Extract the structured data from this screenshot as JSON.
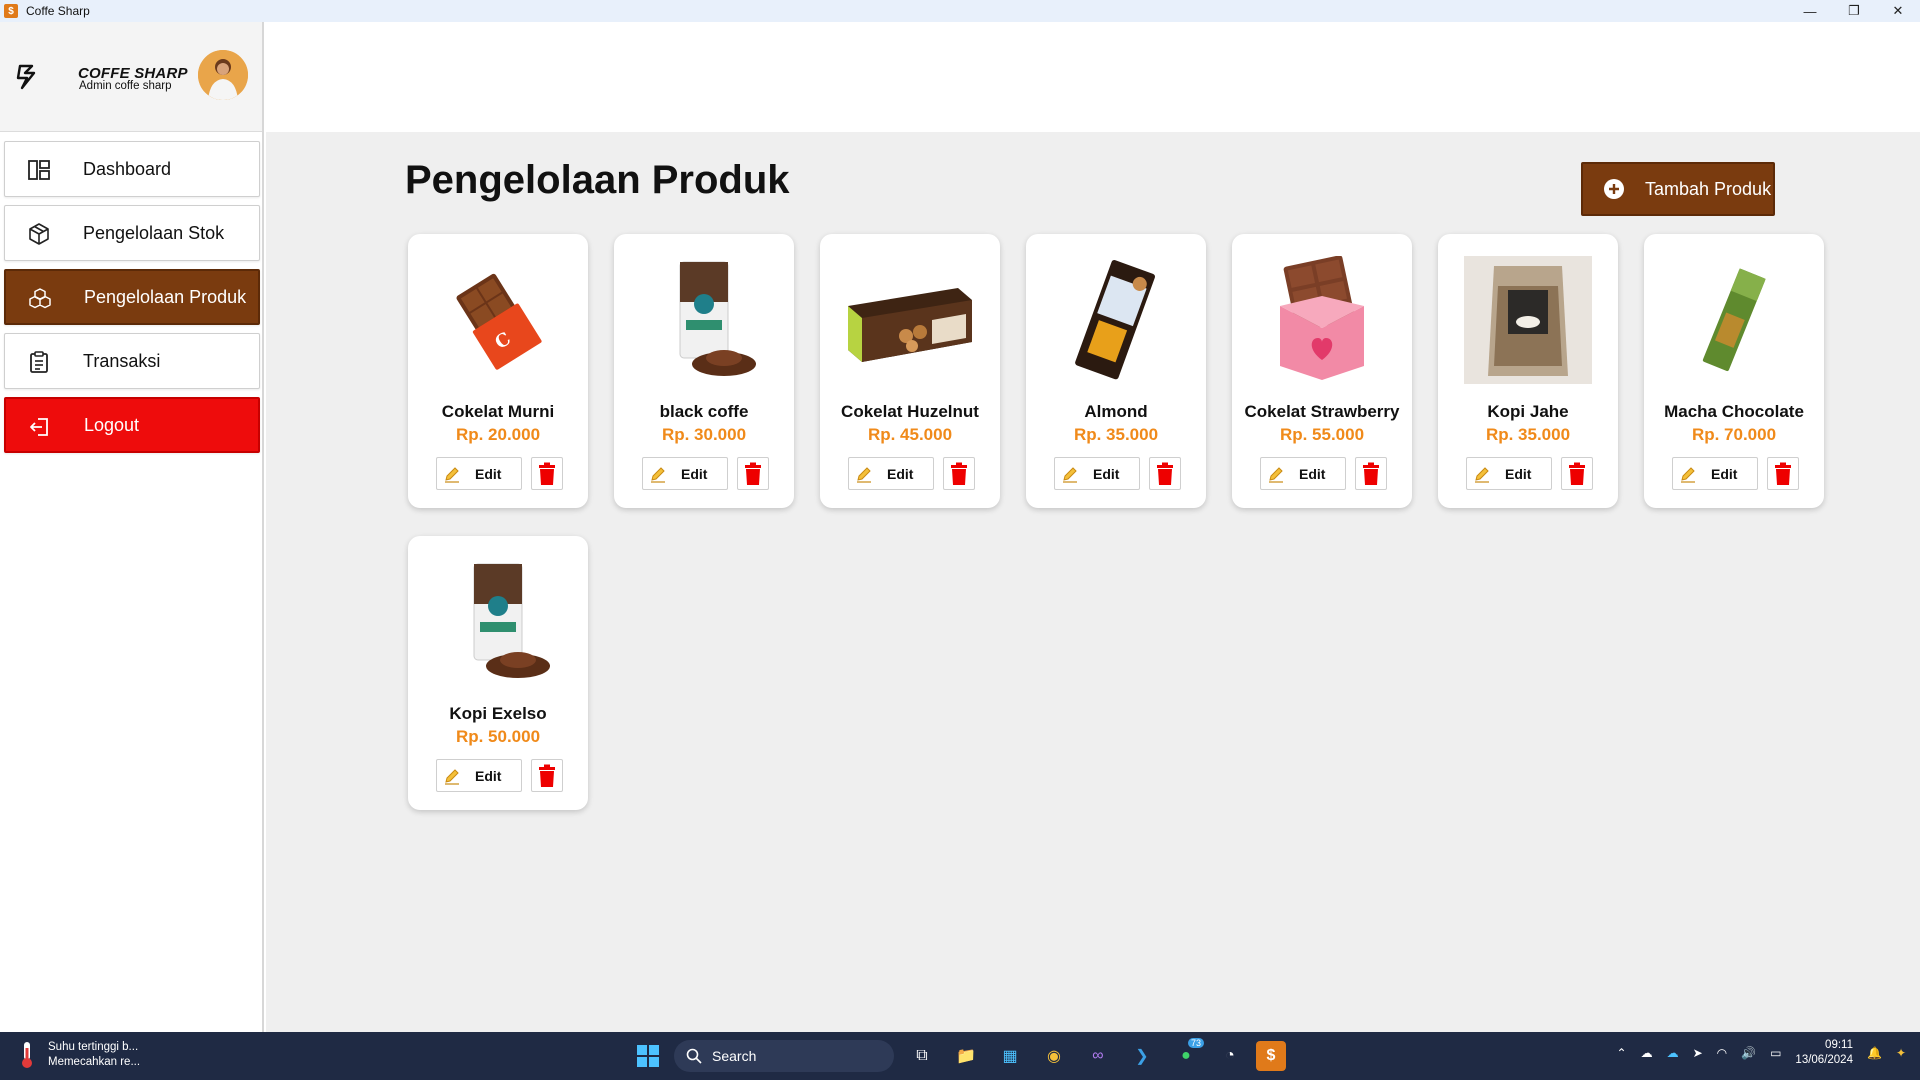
{
  "window": {
    "title": "Coffe Sharp"
  },
  "brand": {
    "name": "COFFE SHARP",
    "role": "Admin coffe sharp"
  },
  "nav": {
    "items": [
      {
        "label": "Dashboard",
        "icon": "dashboard-icon"
      },
      {
        "label": "Pengelolaan Stok",
        "icon": "box-icon"
      },
      {
        "label": "Pengelolaan Produk",
        "icon": "boxes-icon",
        "active": true
      },
      {
        "label": "Transaksi",
        "icon": "clipboard-icon"
      }
    ],
    "logout": "Logout"
  },
  "main": {
    "title": "Pengelolaan Produk",
    "add_button": "Tambah Produk",
    "edit_label": "Edit"
  },
  "products": [
    {
      "name": "Cokelat Murni",
      "price": "Rp. 20.000"
    },
    {
      "name": "black coffe",
      "price": "Rp. 30.000"
    },
    {
      "name": "Cokelat Huzelnut",
      "price": "Rp. 45.000"
    },
    {
      "name": "Almond",
      "price": "Rp. 35.000"
    },
    {
      "name": "Cokelat Strawberry",
      "price": "Rp. 55.000"
    },
    {
      "name": "Kopi Jahe",
      "price": "Rp. 35.000"
    },
    {
      "name": "Macha Chocolate",
      "price": "Rp. 70.000"
    },
    {
      "name": "Kopi Exelso",
      "price": "Rp. 50.000"
    }
  ],
  "taskbar": {
    "weather_title": "Suhu tertinggi b...",
    "weather_sub": "Memecahkan re...",
    "search": "Search",
    "whatsapp_badge": "73",
    "time": "09:11",
    "date": "13/06/2024"
  },
  "colors": {
    "brand_brown": "#7a3b0f",
    "logout_red": "#ee0c0c",
    "price_orange": "#f08a1a",
    "background": "#efefef"
  }
}
